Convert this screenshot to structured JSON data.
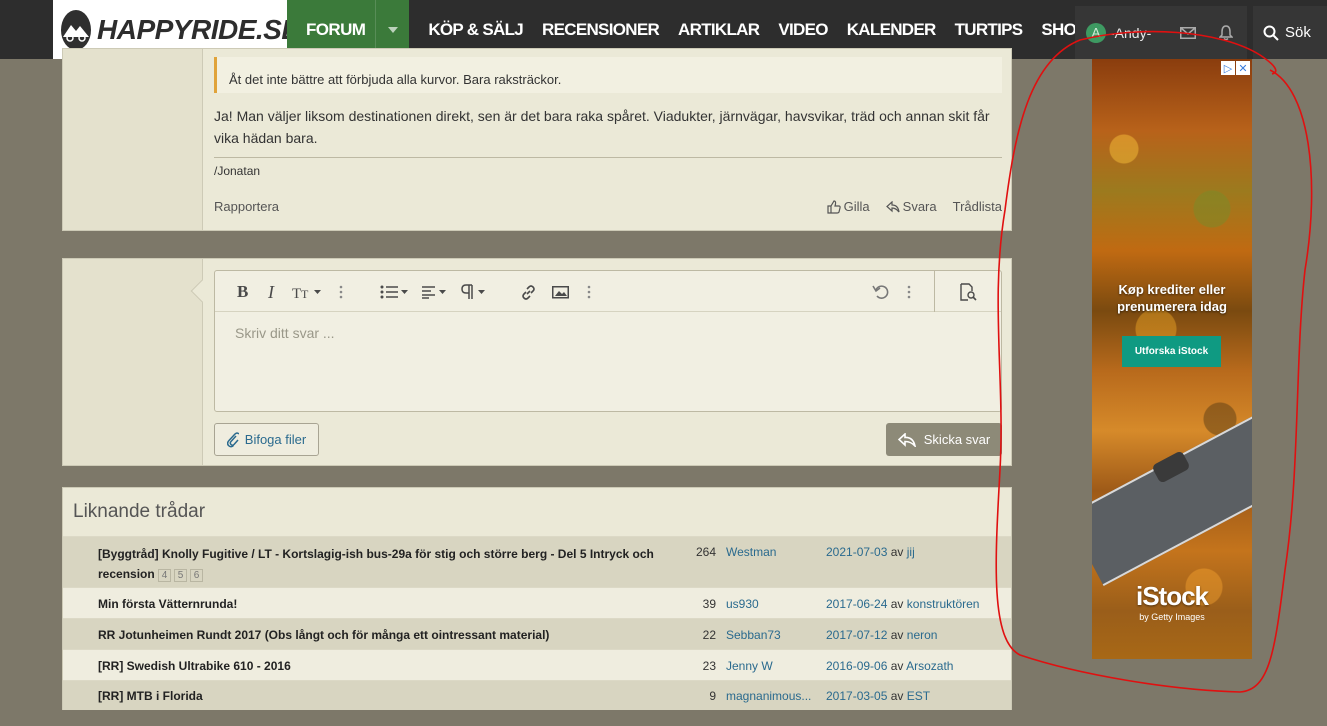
{
  "header": {
    "logo_text": "HAPPYRIDE.SE",
    "nav": {
      "forum": "FORUM",
      "items": [
        "KÖP & SÄLJ",
        "RECENSIONER",
        "ARTIKLAR",
        "VIDEO",
        "KALENDER",
        "TURTIPS",
        "SHOP"
      ]
    },
    "user": {
      "avatar_letter": "A",
      "name": "-Andy-"
    },
    "search_label": "Sök",
    "accent": "#3b7a3a"
  },
  "post": {
    "quote": "Åt det inte bättre att förbjuda alla kurvor. Bara raksträckor.",
    "body": "Ja! Man väljer liksom destinationen direkt, sen är det bara raka spåret. Viadukter, järnvägar, havsvikar, träd och annan skit får vika hädan bara.",
    "signature": "/Jonatan",
    "actions": {
      "report": "Rapportera",
      "like": "Gilla",
      "reply": "Svara",
      "thread_list": "Trådlista"
    }
  },
  "reply_box": {
    "placeholder": "Skriv ditt svar ...",
    "attach_label": "Bifoga filer",
    "send_label": "Skicka svar"
  },
  "similar": {
    "title": "Liknande trådar",
    "rows": [
      {
        "title": "[Byggtråd] Knolly Fugitive / LT - Kortslagig-ish bus-29a för stig och större berg - Del 5 Intryck och recension",
        "pages": [
          "4",
          "5",
          "6"
        ],
        "count": "264",
        "user": "Westman",
        "date": "2021-07-03",
        "by": "av",
        "last_user": "jij"
      },
      {
        "title": "Min första Vätternrunda!",
        "pages": [],
        "count": "39",
        "user": "us930",
        "date": "2017-06-24",
        "by": "av",
        "last_user": "konstruktören"
      },
      {
        "title": "RR Jotunheimen Rundt 2017 (Obs långt och för många ett ointressant material)",
        "pages": [],
        "count": "22",
        "user": "Sebban73",
        "date": "2017-07-12",
        "by": "av",
        "last_user": "neron"
      },
      {
        "title": "[RR] Swedish Ultrabike 610 - 2016",
        "pages": [],
        "count": "23",
        "user": "Jenny W",
        "date": "2016-09-06",
        "by": "av",
        "last_user": "Arsozath"
      },
      {
        "title": "[RR] MTB i Florida",
        "pages": [],
        "count": "9",
        "user": "magnanimous...",
        "date": "2017-03-05",
        "by": "av",
        "last_user": "EST"
      }
    ]
  },
  "ad": {
    "headline": "Køp krediter eller prenumerera idag",
    "cta": "Utforska iStock",
    "brand": "iStock",
    "brand_sub": "by Getty Images",
    "cta_color": "#0f9a82"
  },
  "annotation_color": "#e01010"
}
